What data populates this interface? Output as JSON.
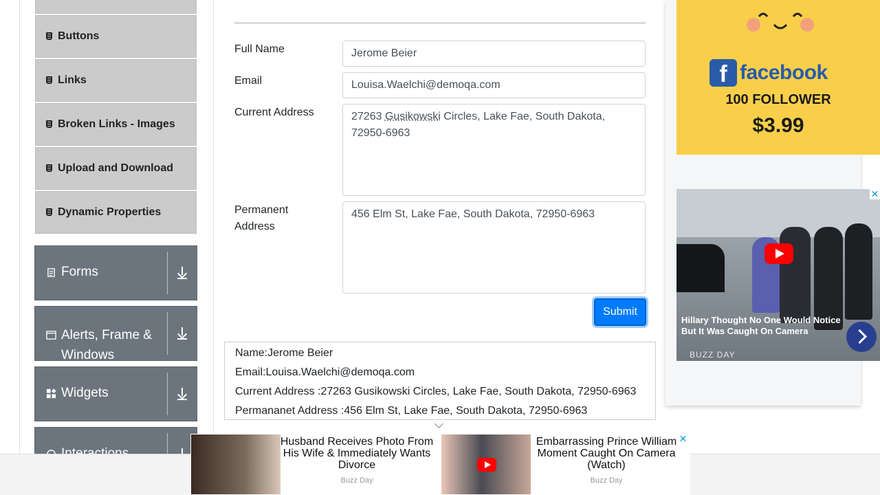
{
  "sidebar": {
    "items": [
      {
        "label": "Buttons"
      },
      {
        "label": "Links"
      },
      {
        "label": "Broken Links - Images"
      },
      {
        "label": "Upload and Download"
      },
      {
        "label": "Dynamic Properties"
      }
    ],
    "groups": [
      {
        "label": "Forms"
      },
      {
        "label": "Alerts, Frame & Windows"
      },
      {
        "label": "Widgets"
      },
      {
        "label": "Interactions"
      }
    ]
  },
  "form": {
    "full_name_label": "Full Name",
    "full_name_value": "Jerome Beier",
    "email_label": "Email",
    "email_value": "Louisa.Waelchi@demoqa.com",
    "current_address_label": "Current Address",
    "current_address_value_pre": "27263 ",
    "current_address_value_word": "Gusikowski",
    "current_address_value_post": " Circles, Lake Fae, South Dakota, 72950-6963",
    "permanent_address_label": "Permanent Address",
    "permanent_address_value": "456 Elm St, Lake Fae, South Dakota, 72950-6963",
    "submit_label": "Submit"
  },
  "output": {
    "name": "Name:Jerome Beier",
    "email": "Email:Louisa.Waelchi@demoqa.com",
    "current_address": "Current Address :27263 Gusikowski Circles, Lake Fae, South Dakota, 72950-6963",
    "permanent_address": "Permananet Address :456 Elm St, Lake Fae, South Dakota, 72950-6963"
  },
  "ads": {
    "facebook": {
      "brand": "facebook",
      "brand_letter": "f",
      "followers": "100 FOLLOWER",
      "price": "$3.99"
    },
    "video": {
      "caption": "Hillary Thought No One Would Notice But It Was Caught On Camera",
      "source": "BUZZ DAY",
      "close": "✕"
    },
    "bottom": [
      {
        "title": "Husband Receives Photo From His Wife & Immediately Wants Divorce",
        "source": "Buzz Day"
      },
      {
        "title": "Embarrassing Prince William Moment Caught On Camera (Watch)",
        "source": "Buzz Day"
      }
    ],
    "bottom_close": "✕"
  },
  "colors": {
    "primary": "#007bff",
    "sidebar_item_bg": "#cbcbcb",
    "group_bg": "#6c757d",
    "facebook_blue": "#2a5ba8",
    "ad_yellow": "#f9cf4a"
  }
}
